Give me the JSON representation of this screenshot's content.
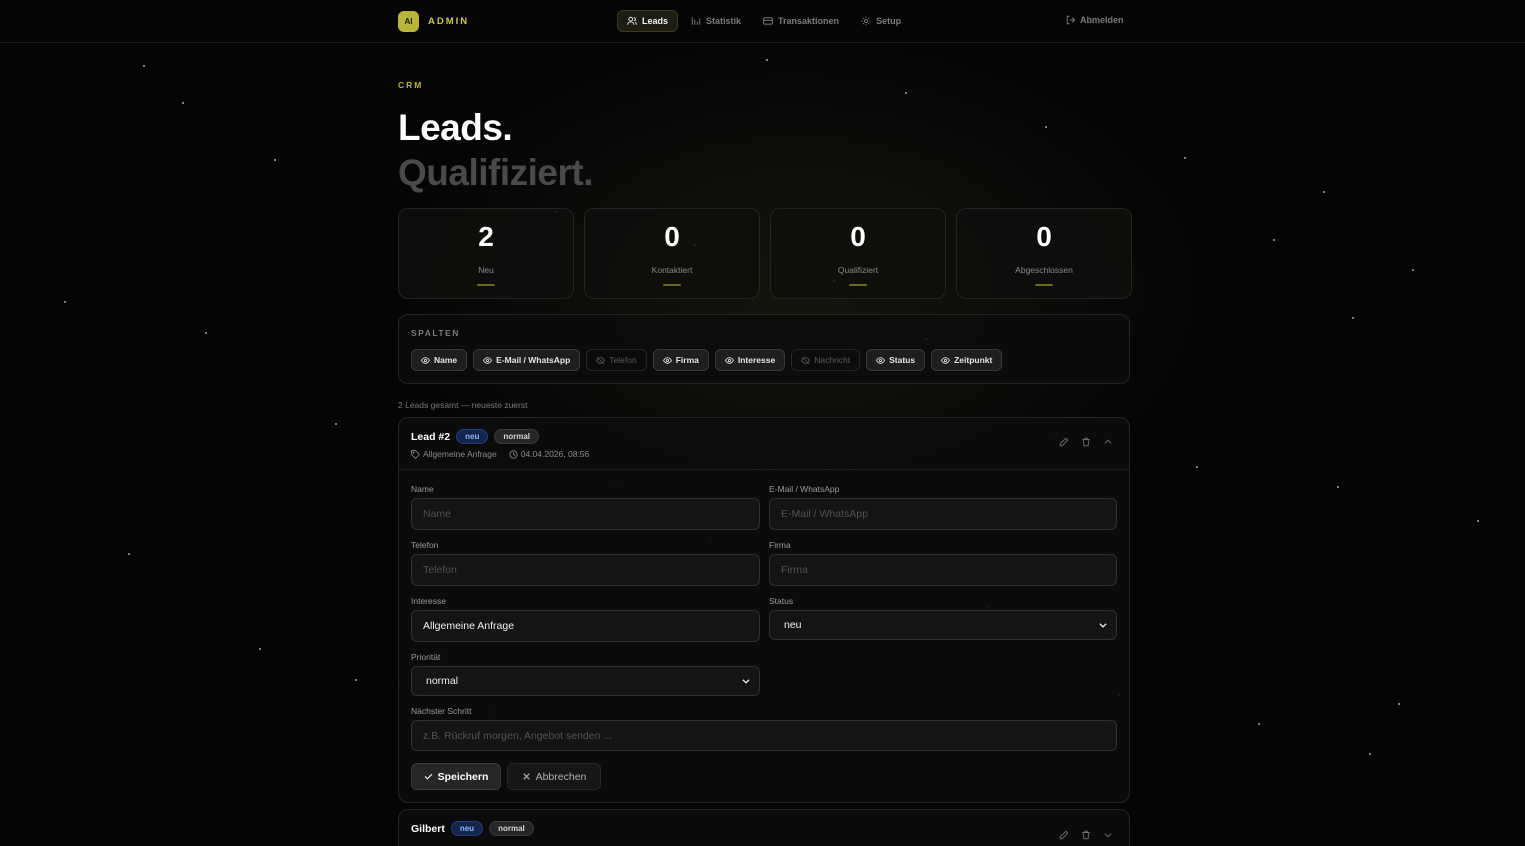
{
  "brand": {
    "logo_text": "AI",
    "name": "ADMIN"
  },
  "nav": {
    "items": [
      {
        "label": "Leads",
        "icon": "users-icon",
        "active": true
      },
      {
        "label": "Statistik",
        "icon": "bar-chart-icon",
        "active": false
      },
      {
        "label": "Transaktionen",
        "icon": "card-icon",
        "active": false
      },
      {
        "label": "Setup",
        "icon": "gear-icon",
        "active": false
      }
    ],
    "logout_label": "Abmelden"
  },
  "header": {
    "eyebrow": "CRM",
    "title_line1": "Leads.",
    "title_line2": "Qualifiziert."
  },
  "stats": [
    {
      "value": "2",
      "label": "Neu"
    },
    {
      "value": "0",
      "label": "Kontaktiert"
    },
    {
      "value": "0",
      "label": "Qualifiziert"
    },
    {
      "value": "0",
      "label": "Abgeschlossen"
    }
  ],
  "columns": {
    "label": "SPALTEN",
    "chips": [
      {
        "label": "Name",
        "visible": true
      },
      {
        "label": "E-Mail / WhatsApp",
        "visible": true
      },
      {
        "label": "Telefon",
        "visible": false
      },
      {
        "label": "Firma",
        "visible": true
      },
      {
        "label": "Interesse",
        "visible": true
      },
      {
        "label": "Nachricht",
        "visible": false
      },
      {
        "label": "Status",
        "visible": true
      },
      {
        "label": "Zeitpunkt",
        "visible": true
      }
    ]
  },
  "list": {
    "count_text": "2 Leads gesamt — neueste zuerst"
  },
  "lead1": {
    "title": "Lead #2",
    "status_badge": "neu",
    "priority_badge": "normal",
    "interest": "Allgemeine Anfrage",
    "timestamp": "04.04.2026, 08:56",
    "form": {
      "name_label": "Name",
      "name_placeholder": "Name",
      "email_label": "E-Mail / WhatsApp",
      "email_placeholder": "E-Mail / WhatsApp",
      "phone_label": "Telefon",
      "phone_placeholder": "Telefon",
      "company_label": "Firma",
      "company_placeholder": "Firma",
      "interest_label": "Interesse",
      "interest_value": "Allgemeine Anfrage",
      "status_label": "Status",
      "status_value": "neu",
      "priority_label": "Priorität",
      "priority_value": "normal",
      "next_label": "Nächster Schritt",
      "next_placeholder": "z.B. Rückruf morgen, Angebot senden ..."
    },
    "save_label": "Speichern",
    "cancel_label": "Abbrechen"
  },
  "lead2": {
    "title": "Gilbert",
    "status_badge": "neu",
    "priority_badge": "normal"
  }
}
